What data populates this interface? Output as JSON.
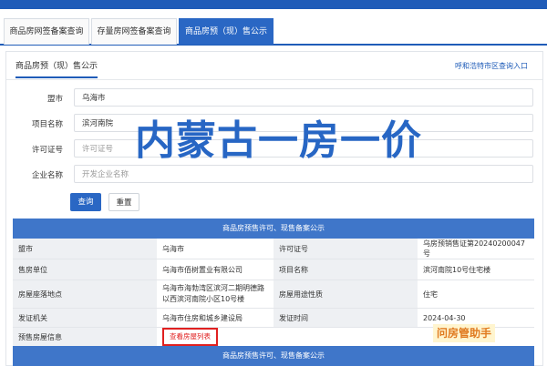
{
  "top_tabs": [
    {
      "label": "商品房网签备案查询"
    },
    {
      "label": "存量房网签备案查询"
    },
    {
      "label": "商品房预（现）售公示"
    }
  ],
  "panel": {
    "title": "商品房预（现）售公示",
    "city_link": "呼和浩特市区查询入口"
  },
  "form": {
    "city": {
      "label": "盟市",
      "value": "乌海市"
    },
    "project": {
      "label": "项目名称",
      "value": "滨河南院"
    },
    "permit": {
      "label": "许可证号",
      "placeholder": "许可证号"
    },
    "company": {
      "label": "企业名称",
      "placeholder": "开发企业名称"
    },
    "query_button": "查询",
    "reset_button": "重置"
  },
  "overlay_title": "内蒙古一房一价",
  "table": {
    "header": "商品房预售许可、现售备案公示",
    "rows": [
      {
        "l1": "盟市",
        "v1": "乌海市",
        "l2": "许可证号",
        "v2": "乌房预销售证第20240200047号"
      },
      {
        "l1": "售房单位",
        "v1": "乌海市佰树置业有限公司",
        "l2": "项目名称",
        "v2": "滨河南院10号住宅楼"
      },
      {
        "l1": "房屋座落地点",
        "v1": "乌海市海勃湾区滨河二期明德路以西滨河南院小区10号楼",
        "l2": "房屋用途性质",
        "v2": "住宅"
      },
      {
        "l1": "发证机关",
        "v1": "乌海市住房和城乡建设局",
        "l2": "发证时间",
        "v2": "2024-04-30"
      },
      {
        "l1": "预售房屋信息",
        "v1": "查看房屋列表",
        "l2": "",
        "v2": ""
      }
    ],
    "footer": "商品房预售许可、现售备案公示"
  },
  "watermark": "问房管助手",
  "colors": {
    "primary": "#2a67c4",
    "header": "#3f76c9",
    "alert": "#e02020"
  }
}
